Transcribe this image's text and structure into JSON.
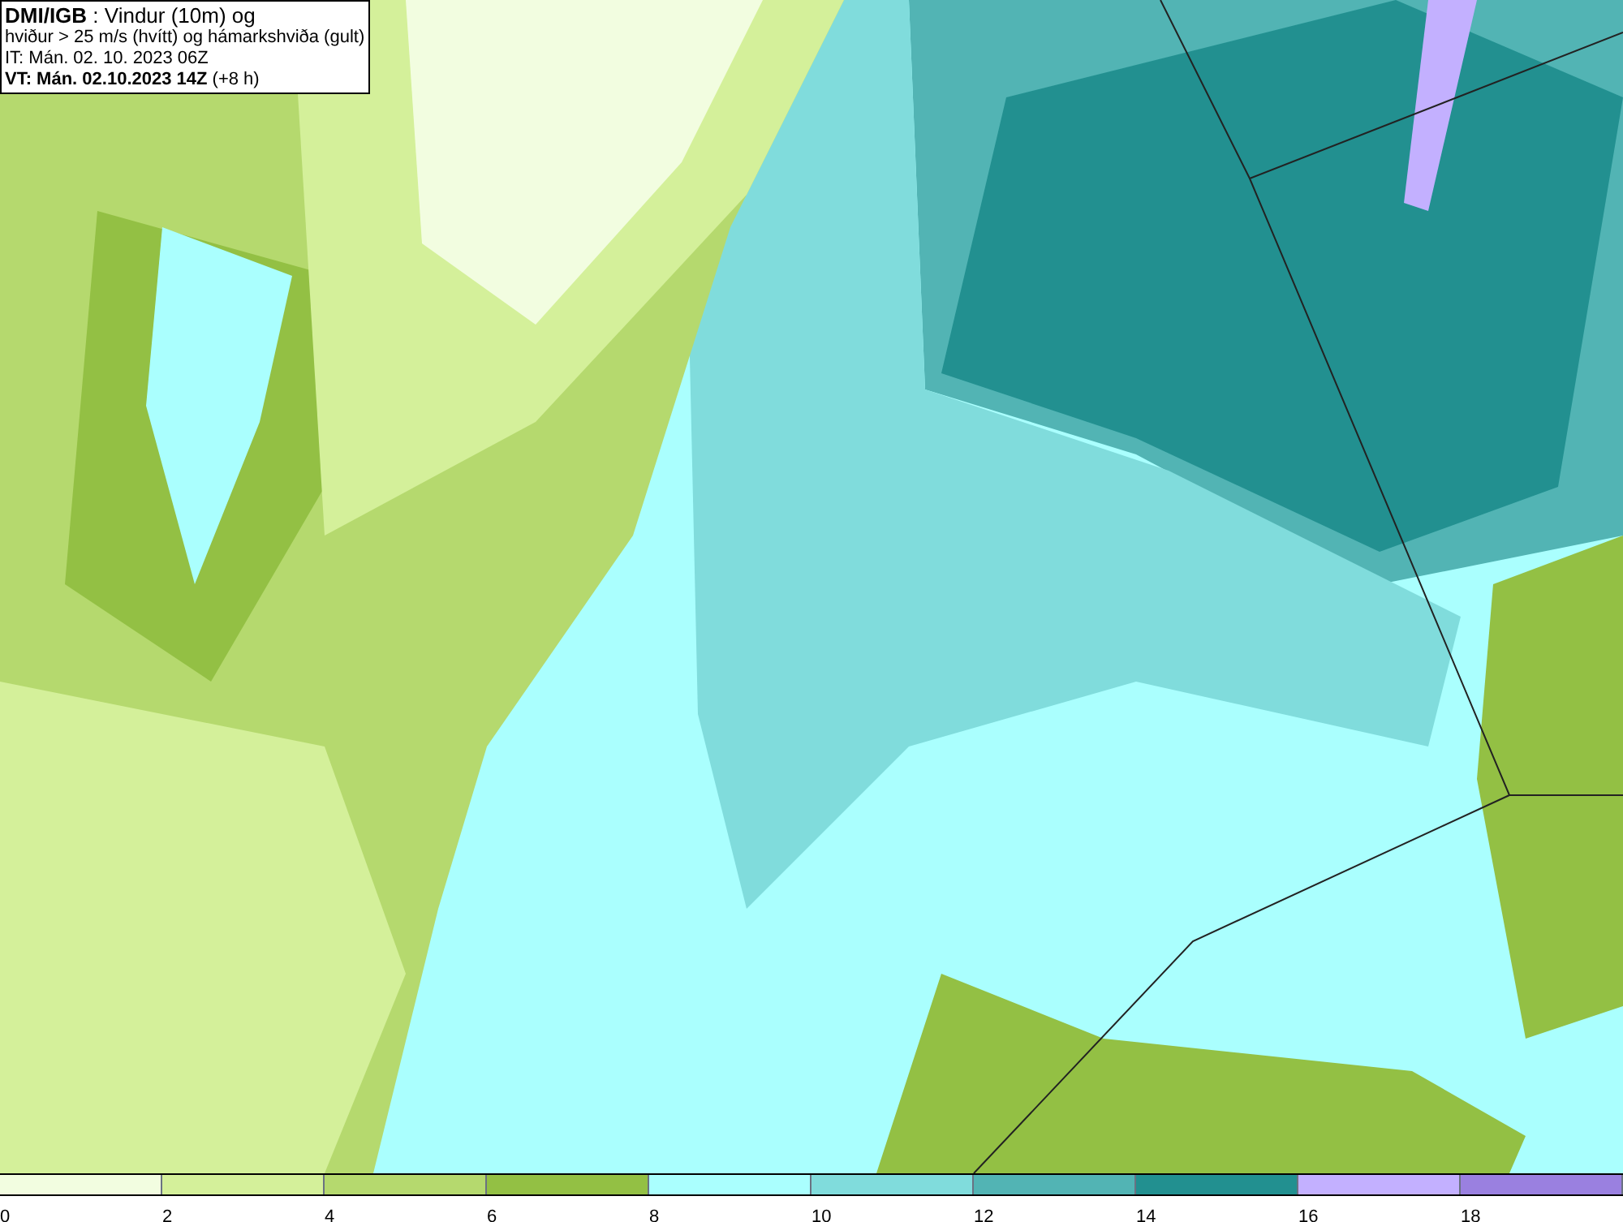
{
  "title_box": {
    "lines": [
      "**DMI/IGB** : Vindur (10m) og",
      "hviður > 25 m/s (hvítt) og hámarkshviða (gult)",
      "IT: Mán. 02. 10. 2023 06Z",
      "**VT: Mán. 02.10.2023 14Z** (+8 h)"
    ]
  },
  "legend": {
    "segments": [
      {
        "color": "#f2fde0"
      },
      {
        "color": "#d4f09a"
      },
      {
        "color": "#b5d96e"
      },
      {
        "color": "#93c044"
      },
      {
        "color": "#aafffe"
      },
      {
        "color": "#80dcdc"
      },
      {
        "color": "#52b4b4"
      },
      {
        "color": "#229090"
      },
      {
        "color": "#c3b0ff"
      },
      {
        "color": "#9a80e0"
      }
    ],
    "ticks": [
      "0",
      "2",
      "4",
      "6",
      "8",
      "10",
      "12",
      "14",
      "16",
      "18"
    ]
  }
}
